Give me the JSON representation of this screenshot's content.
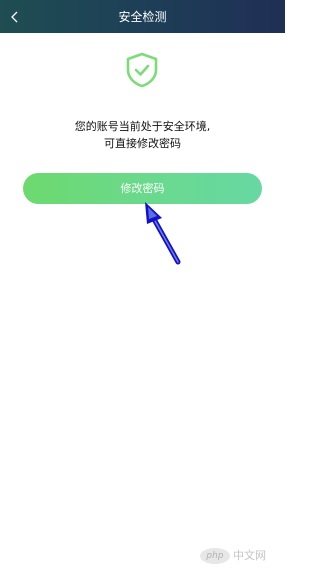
{
  "header": {
    "title": "安全检测",
    "back_icon": "chevron-left-icon"
  },
  "status": {
    "icon": "shield-check-icon",
    "message_line1": "您的账号当前处于安全环境,",
    "message_line2": "可直接修改密码"
  },
  "actions": {
    "change_password_label": "修改密码"
  },
  "annotation": {
    "icon": "pointer-arrow-icon"
  },
  "watermark": {
    "logo_text": "php",
    "site_text": "中文网"
  },
  "colors": {
    "header_bg": "#1f3f57",
    "accent_green": "#6ad98f",
    "shield_green": "#7ddc7a",
    "arrow_blue": "#1111cc"
  }
}
